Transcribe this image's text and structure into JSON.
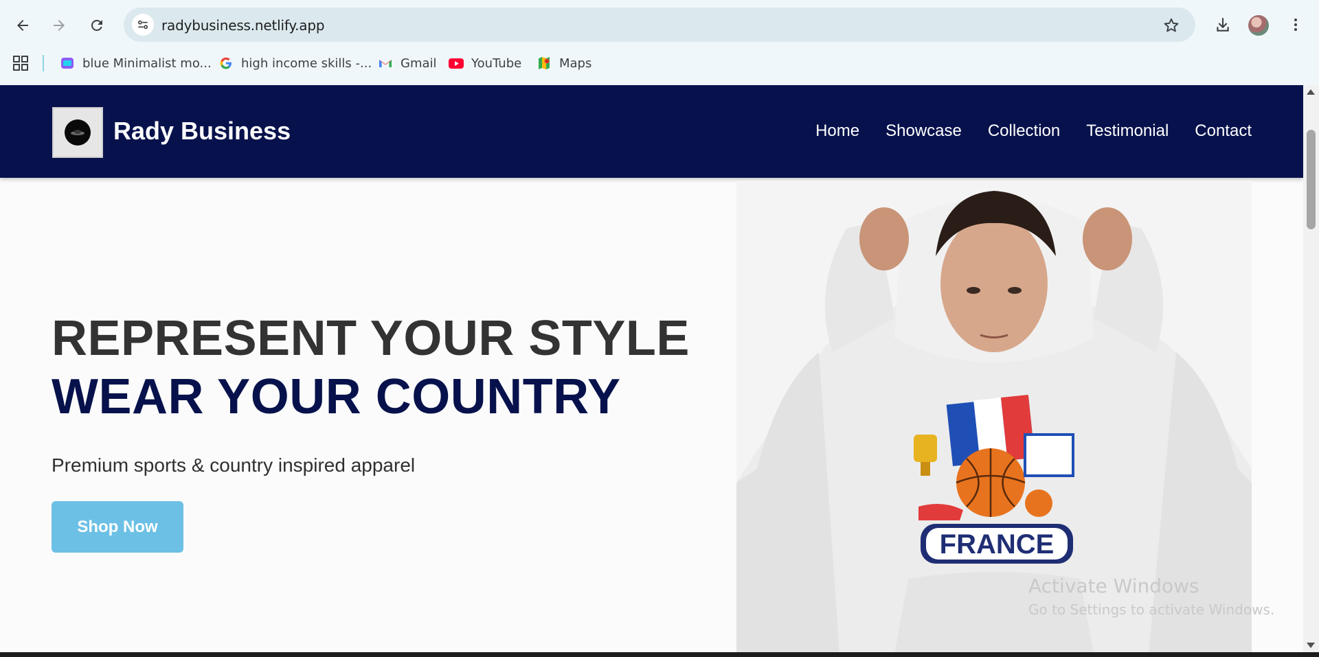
{
  "browser": {
    "url": "radybusiness.netlify.app",
    "bookmarks": [
      {
        "label": "blue Minimalist mo...",
        "icon": "canva-icon"
      },
      {
        "label": "high income skills -...",
        "icon": "google-icon"
      },
      {
        "label": "Gmail",
        "icon": "gmail-icon"
      },
      {
        "label": "YouTube",
        "icon": "youtube-icon"
      },
      {
        "label": "Maps",
        "icon": "maps-icon"
      }
    ]
  },
  "site": {
    "brand": "Rady Business",
    "nav": [
      "Home",
      "Showcase",
      "Collection",
      "Testimonial",
      "Contact"
    ],
    "hero": {
      "line1": "REPRESENT YOUR STYLE",
      "line2": "WEAR YOUR COUNTRY",
      "subtitle": "Premium sports & country inspired apparel",
      "cta": "Shop Now",
      "image_text": "FRANCE"
    },
    "colors": {
      "header_bg": "#07124c",
      "accent": "#6cc0e5",
      "heading_dark": "#333333",
      "heading_navy": "#07124c"
    }
  },
  "overlay": {
    "watermark_title": "Activate Windows",
    "watermark_sub": "Go to Settings to activate Windows."
  }
}
